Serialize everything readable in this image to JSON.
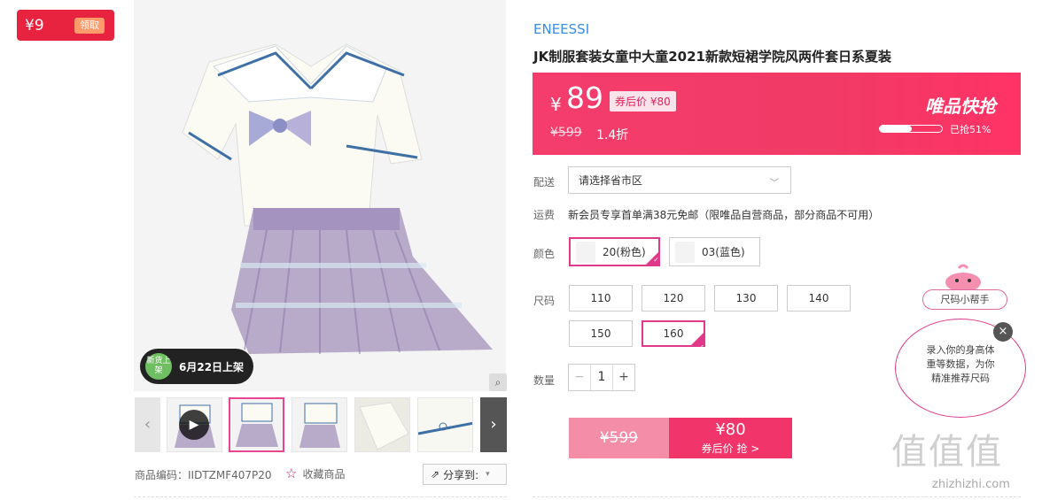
{
  "coupon_tag": {
    "amount": "¥9",
    "get_label": "领取"
  },
  "launch_badge": {
    "dot_text": "新货上架",
    "date_text": "6月22日上架"
  },
  "sku": {
    "code_text": "商品编码：IIDTZMF407P20",
    "favorite_label": "收藏商品",
    "share_label": "分享到:"
  },
  "product": {
    "brand": "ENEESSI",
    "title": "JK制服套装女童中大童2021新款短裙学院风两件套日系夏装"
  },
  "price": {
    "yen": "¥",
    "current": "89",
    "coupon_price": "券后价 ¥80",
    "original": "¥599",
    "discount": "1.4折",
    "flash_label": "唯品快抢",
    "sold_text": "已抢51%",
    "sold_fraction": 0.51
  },
  "delivery": {
    "label": "配送",
    "placeholder": "请选择省市区"
  },
  "shipping": {
    "label": "运费",
    "text": "新会员专享首单满38元免邮（限唯品自营商品，部分商品不可用）"
  },
  "color": {
    "label": "颜色",
    "options": [
      {
        "text": "20(粉色)",
        "selected": true
      },
      {
        "text": "03(蓝色)",
        "selected": false
      }
    ]
  },
  "size": {
    "label": "尺码",
    "options": [
      "110",
      "120",
      "130",
      "140",
      "150",
      "160"
    ],
    "selected": "160"
  },
  "quantity": {
    "label": "数量",
    "value": "1",
    "minus": "−",
    "plus": "+"
  },
  "buy": {
    "original": "¥599",
    "price": "¥80",
    "sub": "券后价 抢 >"
  },
  "helper": {
    "label": "尺码小帮手",
    "line1": "录入你的身高体",
    "line2": "重等数据，为你",
    "line3": "精准推荐尺码",
    "close": "×"
  },
  "watermark": {
    "big": "值值值",
    "site": "zhizhizhi.com"
  },
  "colors": {
    "accent": "#f1356a",
    "brand_blue": "#3a8de2",
    "select_border": "#e0398a"
  }
}
